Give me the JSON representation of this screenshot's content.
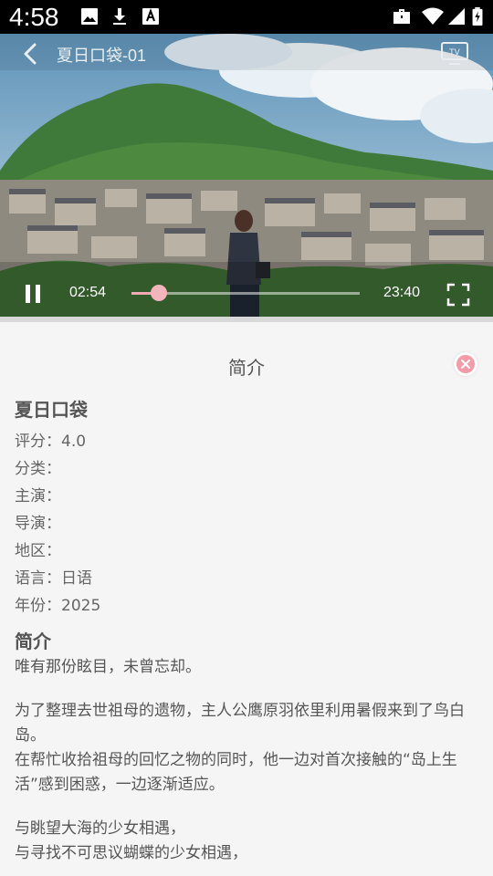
{
  "status_bar": {
    "time": "4:58",
    "icons": [
      "image-icon",
      "download-icon",
      "a-notification-icon",
      "work-briefcase-icon",
      "wifi-icon",
      "signal-icon",
      "battery-charging-icon"
    ]
  },
  "player": {
    "title": "夏日口袋-01",
    "current_time": "02:54",
    "duration": "23:40",
    "progress": 0.12,
    "accent_color": "#f1a9b3"
  },
  "panel": {
    "title": "简介",
    "name": "夏日口袋",
    "fields": [
      {
        "label": "评分：",
        "value": "4.0"
      },
      {
        "label": "分类：",
        "value": ""
      },
      {
        "label": "主演：",
        "value": ""
      },
      {
        "label": "导演：",
        "value": ""
      },
      {
        "label": "地区：",
        "value": ""
      },
      {
        "label": "语言：",
        "value": "日语"
      },
      {
        "label": "年份：",
        "value": "2025"
      }
    ],
    "synopsis_heading": "简介",
    "synopsis": [
      "唯有那份眩目，未曾忘却。",
      "为了整理去世祖母的遗物，主人公鹰原羽依里利用暑假来到了鸟白岛。\n在帮忙收拾祖母的回忆之物的同时，他一边对首次接触的“岛上生活”感到困惑，一边逐渐适应。",
      "与眺望大海的少女相遇，\n与寻找不可思议蝴蝶的少女相遇，"
    ]
  }
}
